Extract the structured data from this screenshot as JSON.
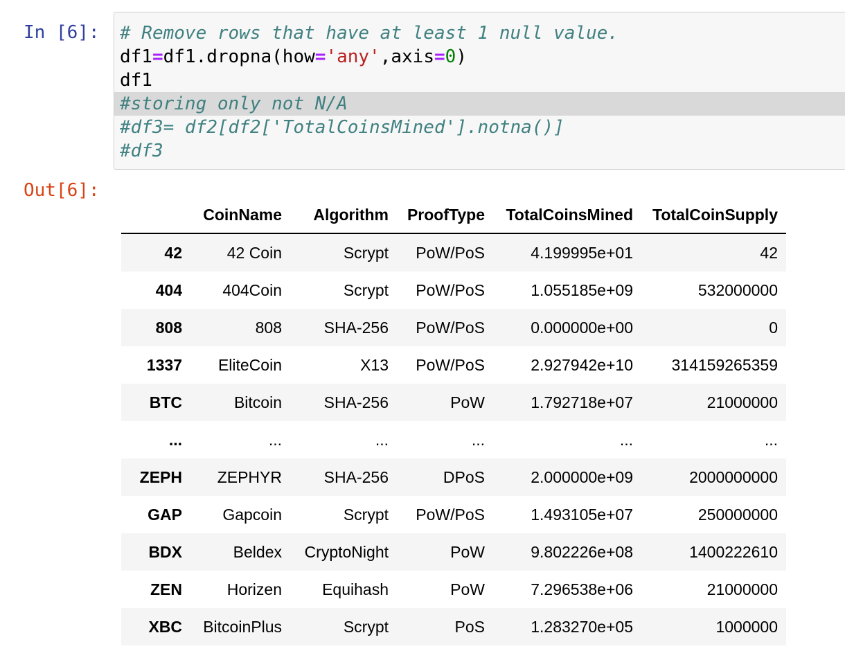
{
  "input_prompt": "In [6]:",
  "output_prompt": "Out[6]:",
  "code": {
    "line1_comment": "# Remove rows that have at least 1 null value.",
    "line2": {
      "a": "df1",
      "eq": "=",
      "b": "df1.dropna(how",
      "eq2": "=",
      "str": "'any'",
      "c": ",axis",
      "eq3": "=",
      "num": "0",
      "d": ")"
    },
    "line3": "df1",
    "line4_comment": "#storing only not N/A",
    "line5_comment": "#df3= df2[df2['TotalCoinsMined'].notna()]",
    "line6_comment": "#df3"
  },
  "table": {
    "columns": [
      "",
      "CoinName",
      "Algorithm",
      "ProofType",
      "TotalCoinsMined",
      "TotalCoinSupply"
    ],
    "rows": [
      [
        "42",
        "42 Coin",
        "Scrypt",
        "PoW/PoS",
        "4.199995e+01",
        "42"
      ],
      [
        "404",
        "404Coin",
        "Scrypt",
        "PoW/PoS",
        "1.055185e+09",
        "532000000"
      ],
      [
        "808",
        "808",
        "SHA-256",
        "PoW/PoS",
        "0.000000e+00",
        "0"
      ],
      [
        "1337",
        "EliteCoin",
        "X13",
        "PoW/PoS",
        "2.927942e+10",
        "314159265359"
      ],
      [
        "BTC",
        "Bitcoin",
        "SHA-256",
        "PoW",
        "1.792718e+07",
        "21000000"
      ],
      [
        "...",
        "...",
        "...",
        "...",
        "...",
        "..."
      ],
      [
        "ZEPH",
        "ZEPHYR",
        "SHA-256",
        "DPoS",
        "2.000000e+09",
        "2000000000"
      ],
      [
        "GAP",
        "Gapcoin",
        "Scrypt",
        "PoW/PoS",
        "1.493105e+07",
        "250000000"
      ],
      [
        "BDX",
        "Beldex",
        "CryptoNight",
        "PoW",
        "9.802226e+08",
        "1400222610"
      ],
      [
        "ZEN",
        "Horizen",
        "Equihash",
        "PoW",
        "7.296538e+06",
        "21000000"
      ],
      [
        "XBC",
        "BitcoinPlus",
        "Scrypt",
        "PoS",
        "1.283270e+05",
        "1000000"
      ]
    ]
  }
}
